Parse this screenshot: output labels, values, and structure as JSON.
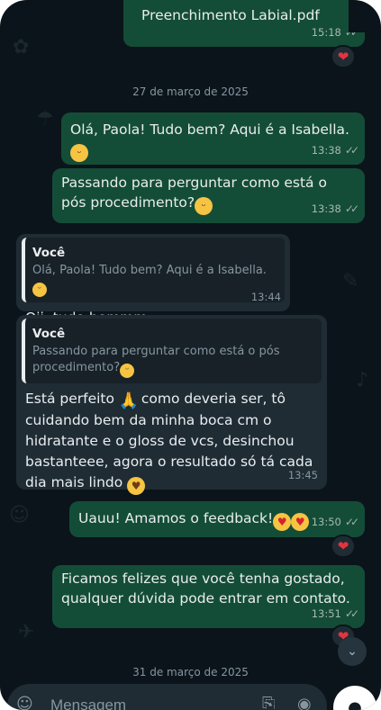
{
  "messages": [
    {
      "id": "m0",
      "text": "Preenchimento Labial.pdf",
      "time": "15:18",
      "reaction": "heart"
    },
    {
      "id": "m1",
      "text": "Olá, Paola! Tudo bem? Aqui é a Isabella.",
      "emoji": "grinning-face",
      "time": "13:38"
    },
    {
      "id": "m2",
      "text": "Passando para perguntar como está o pós procedimento?",
      "emoji": "smiling-face",
      "time": "13:38"
    },
    {
      "id": "m3",
      "quote_author": "Você",
      "quote_text": "Olá, Paola! Tudo bem? Aqui é a Isabella.",
      "text": "Oii, tudo bemmm",
      "time": "13:44"
    },
    {
      "id": "m4",
      "quote_author": "Você",
      "quote_text": "Passando para perguntar como está o pós procedimento?",
      "text_a": "Está perfeito",
      "text_b": "como deveria ser, tô cuidando bem da minha boca cm o hidratante e o gloss de vcs, desinchou bastanteee, agora o resultado só tá cada dia mais lindo",
      "time": "13:45"
    },
    {
      "id": "m5",
      "text": "Uauu! Amamos o feedback!",
      "time": "13:50",
      "reaction": "heart"
    },
    {
      "id": "m6",
      "text": "Ficamos felizes que você tenha gostado, qualquer dúvida pode entrar em contato.",
      "time": "13:51",
      "reaction": "heart"
    }
  ],
  "dates": {
    "d1": "27 de março de 2025",
    "d2": "31 de março de 2025"
  },
  "composer": {
    "placeholder": "Mensagem"
  },
  "colors": {
    "background": "#0b141a",
    "outgoing_bubble": "#144d37",
    "incoming_bubble": "#1f2c34",
    "heart": "#e5333f"
  },
  "icons": [
    "double-check-icon",
    "heart-icon",
    "scroll-down-icon",
    "emoji-icon",
    "attach-icon",
    "camera-icon",
    "mic-icon"
  ]
}
